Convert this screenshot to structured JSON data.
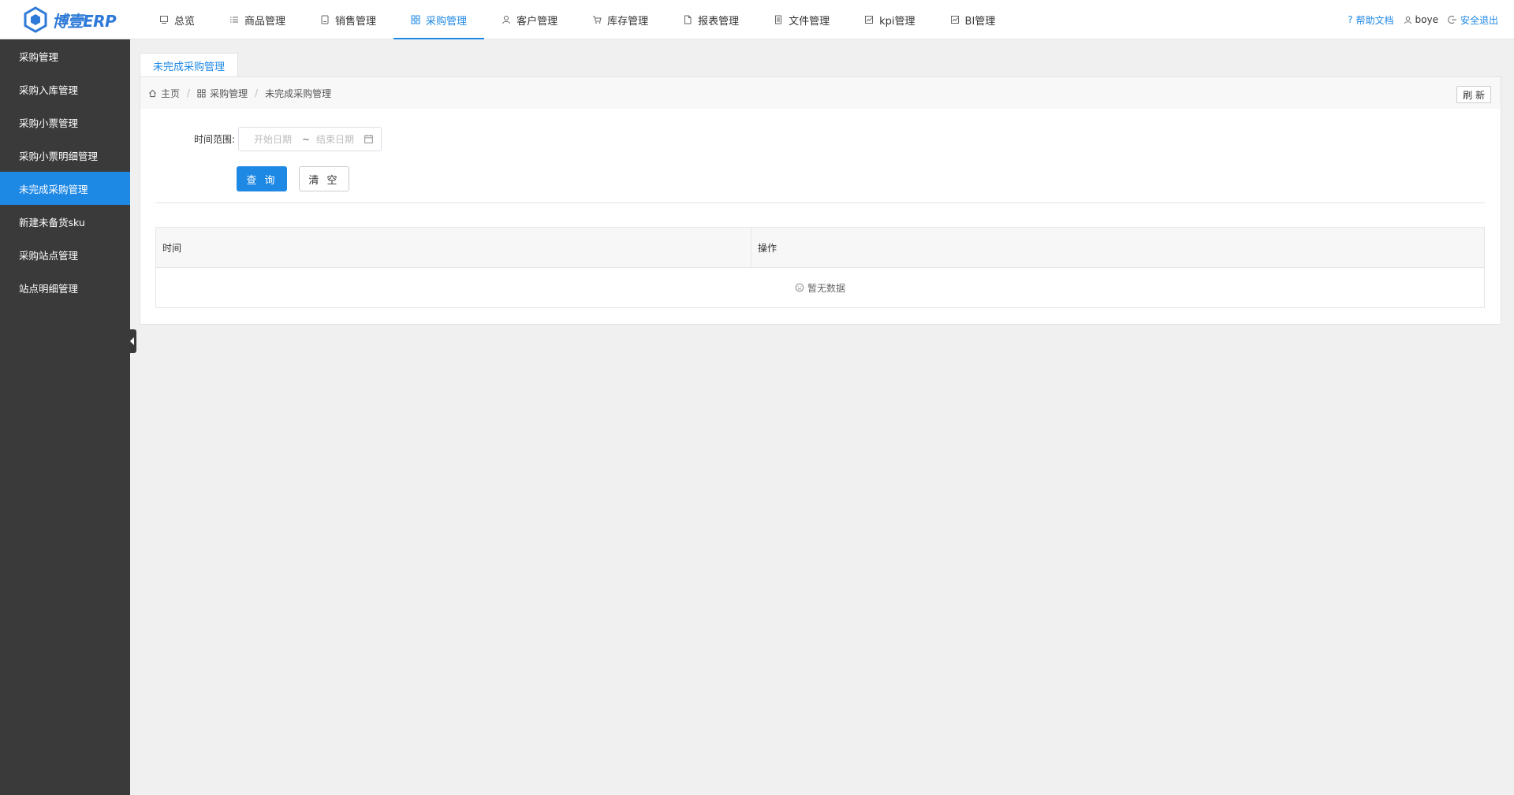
{
  "header": {
    "logo_text": "博壹ERP",
    "nav": [
      {
        "label": "总览",
        "icon": "monitor-icon"
      },
      {
        "label": "商品管理",
        "icon": "list-icon"
      },
      {
        "label": "销售管理",
        "icon": "tablet-icon"
      },
      {
        "label": "采购管理",
        "icon": "grid-icon",
        "active": true
      },
      {
        "label": "客户管理",
        "icon": "user-icon"
      },
      {
        "label": "库存管理",
        "icon": "cart-icon"
      },
      {
        "label": "报表管理",
        "icon": "file-icon"
      },
      {
        "label": "文件管理",
        "icon": "document-icon"
      },
      {
        "label": "kpi管理",
        "icon": "chart-icon"
      },
      {
        "label": "BI管理",
        "icon": "chart-icon"
      }
    ],
    "help": "帮助文档",
    "user": "boye",
    "logout": "安全退出"
  },
  "sidebar": {
    "items": [
      {
        "label": "采购管理"
      },
      {
        "label": "采购入库管理"
      },
      {
        "label": "采购小票管理"
      },
      {
        "label": "采购小票明细管理"
      },
      {
        "label": "未完成采购管理",
        "active": true
      },
      {
        "label": "新建未备货sku"
      },
      {
        "label": "采购站点管理"
      },
      {
        "label": "站点明细管理"
      }
    ]
  },
  "tabs": [
    {
      "label": "未完成采购管理"
    }
  ],
  "breadcrumb": {
    "home": "主页",
    "level1": "采购管理",
    "level2": "未完成采购管理"
  },
  "refresh_label": "刷 新",
  "form": {
    "time_range_label": "时间范围:",
    "start_placeholder": "开始日期",
    "separator": "~",
    "end_placeholder": "结束日期"
  },
  "buttons": {
    "query": "查 询",
    "clear": "清 空"
  },
  "table": {
    "columns": [
      "时间",
      "操作"
    ],
    "empty_text": "暂无数据"
  },
  "colors": {
    "accent": "#1e88e5",
    "sidebar_bg": "#3a3a3a"
  }
}
